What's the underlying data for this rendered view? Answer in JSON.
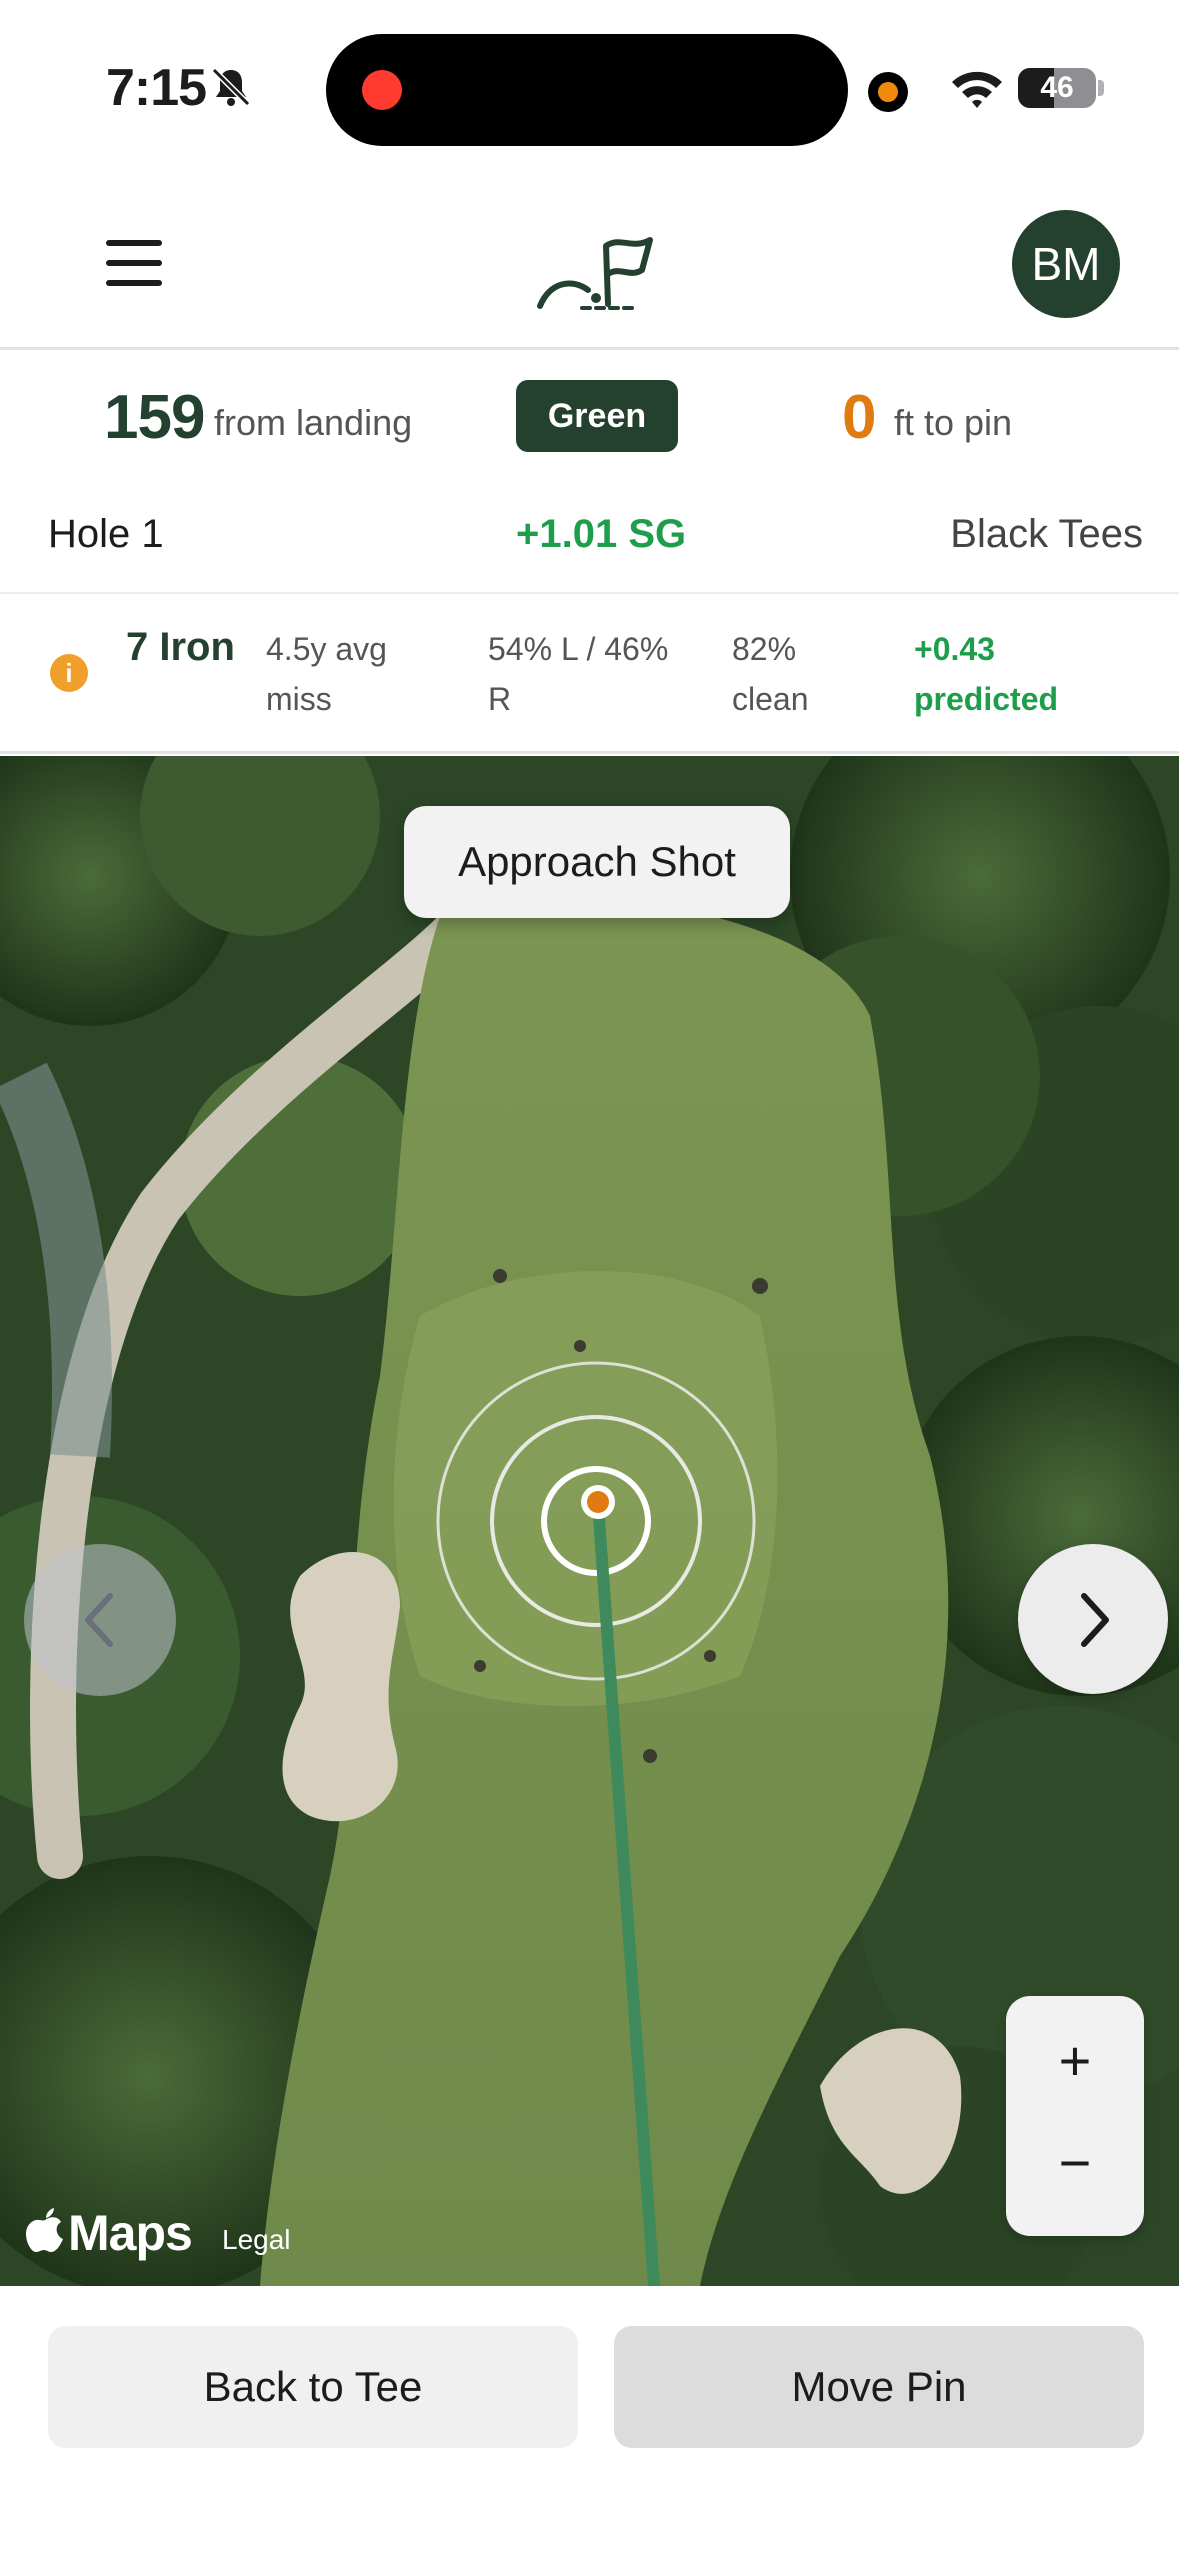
{
  "status_bar": {
    "time": "7:15",
    "battery_level": "46",
    "battery_fraction": 0.46
  },
  "header": {
    "avatar_initials": "BM"
  },
  "distance": {
    "landing_value": "159",
    "landing_label": "from landing",
    "badge": "Green",
    "pin_value": "0",
    "pin_label": "ft to pin"
  },
  "hole": {
    "name": "Hole 1",
    "strokes_gained": "+1.01 SG",
    "tees": "Black Tees"
  },
  "club": {
    "name": "7 Iron",
    "avg_miss": "4.5y avg miss",
    "left_right": "54% L / 46% R",
    "clean": "82% clean",
    "predicted": "+0.43 predicted"
  },
  "map": {
    "shot_type": "Approach Shot",
    "zoom_in": "+",
    "zoom_out": "−",
    "maps_label": "Maps",
    "legal": "Legal"
  },
  "actions": {
    "back_to_tee": "Back to Tee",
    "move_pin": "Move Pin"
  },
  "colors": {
    "brand_dark_green": "#24402f",
    "positive_green": "#1e9d4b",
    "accent_orange": "#e07b12",
    "info_orange": "#f0a02a"
  }
}
